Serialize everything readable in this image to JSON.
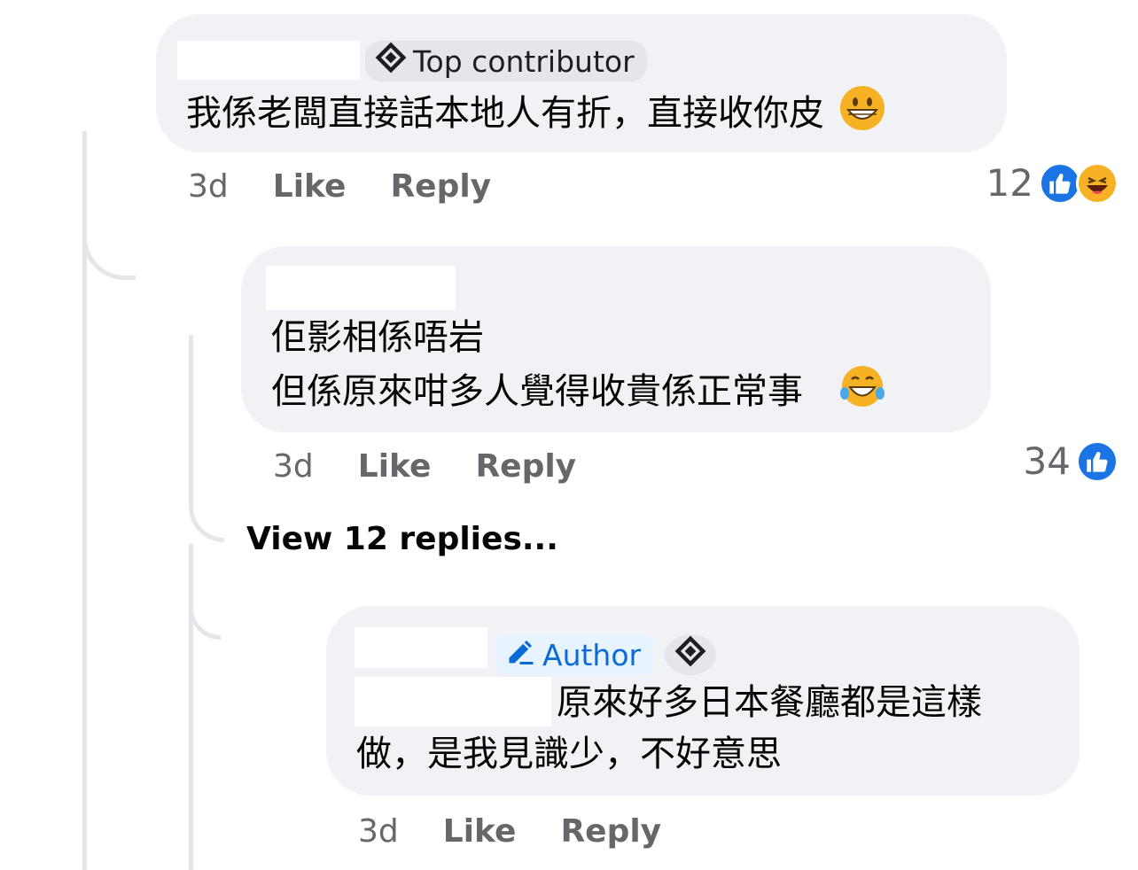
{
  "comments": [
    {
      "badge": "Top contributor",
      "lines": [
        "我係老闆直接話本地人有折，直接收你皮"
      ],
      "emoji": "grinning-face-emoji",
      "time": "3d",
      "like": "Like",
      "reply": "Reply",
      "reaction_count": "12",
      "reactions": [
        "like-icon",
        "haha-icon"
      ]
    },
    {
      "lines": [
        "佢影相係唔岩",
        "但係原來咁多人覺得收貴係正常事"
      ],
      "emoji": "tears-of-joy-emoji",
      "time": "3d",
      "like": "Like",
      "reply": "Reply",
      "reaction_count": "34",
      "reactions": [
        "like-icon"
      ]
    },
    {
      "badge": "Author",
      "lines": [
        "原來好多日本餐廳都是這樣",
        "做，是我見識少，不好意思"
      ],
      "time": "3d",
      "like": "Like",
      "reply": "Reply"
    }
  ],
  "view_replies": "View 12 replies...",
  "colors": {
    "bubble": "#f0f2f5",
    "like_blue": "#1b74e4",
    "author_blue": "#0a6bd8",
    "meta_gray": "#65676b"
  }
}
